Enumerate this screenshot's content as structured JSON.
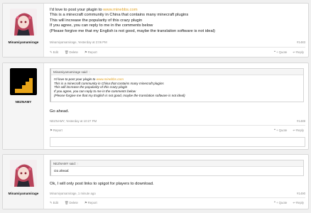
{
  "posts": [
    {
      "username": "Minamiyamamirage",
      "lines": {
        "l1_prefix": "I'd love to post your plugin to ",
        "l1_link": "www.minebbs.com",
        "l2": "This is a minecraft community in China that contains many minecraft plugins",
        "l3": "This will increase the popularity of this crazy plugin",
        "l4": "If you agree, you can reply to me in the comments below",
        "l5": "(Please forgive me that my English is not good, maybe the translation software is not ideal)"
      },
      "meta": "Minamiyamamirage, Yesterday at 2:06 PM",
      "number": "#1483",
      "edit": "Edit",
      "delete": "Delete",
      "report": "Report",
      "quote": "+ Quote",
      "reply": "Reply"
    },
    {
      "username": "NEZNAMY",
      "quote_author": "Minamiyamamirage said:",
      "quote_lines": {
        "l1_prefix": "I'd love to post your plugin to ",
        "l1_link": "www.minebbs.com",
        "l2": "This is a minecraft community in China that contains many minecraft plugins",
        "l3": "This will increase the popularity of this crazy plugin",
        "l4": "If you agree, you can reply to me in the comments below",
        "l5": "(Please forgive me that my English is not good, maybe the translation software is not ideal)"
      },
      "message": "Go ahead.",
      "meta": "NEZNAMY, Yesterday at 10:27 PM",
      "number": "#1489",
      "report": "Report",
      "quote": "+ Quote",
      "reply": "Reply"
    },
    {
      "username": "Minamiyamamirage",
      "quote_author": "NEZNAMY said:",
      "quote_text": "Go ahead.",
      "message": "Ok, I will only post links to spigot for players to download.",
      "meta": "Minamiyamamirage, 1 minute ago",
      "number": "#1490",
      "edit": "Edit",
      "delete": "Delete",
      "report": "Report",
      "quote": "+ Quote",
      "reply": "Reply"
    }
  ],
  "colors": {
    "link": "#e0a020",
    "meta": "#8c8c8c",
    "background": "#f0f0f0"
  },
  "icons": [
    "anime-avatar",
    "pixel-avatar",
    "pencil-icon",
    "trash-icon",
    "flag-icon",
    "quote-icon",
    "reply-icon"
  ]
}
